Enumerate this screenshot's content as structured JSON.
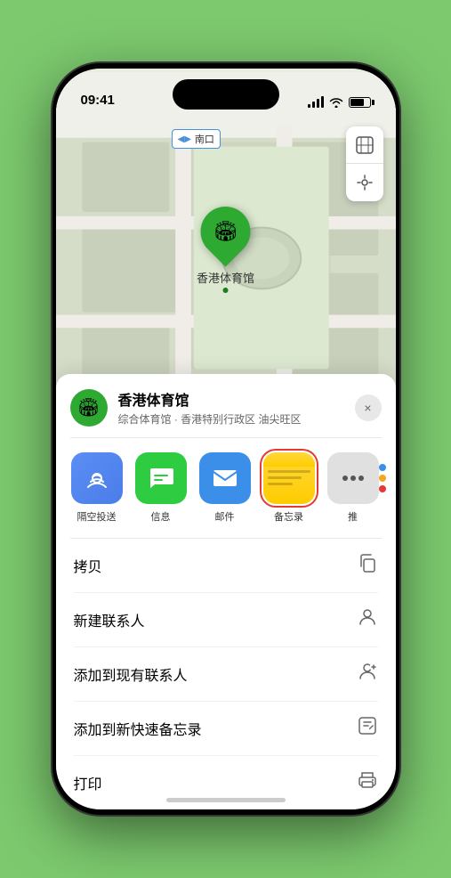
{
  "status_bar": {
    "time": "09:41",
    "location_icon": "▶"
  },
  "map": {
    "label_text": "南口",
    "pin_label": "香港体育馆",
    "controls": {
      "map_icon": "🗺",
      "location_icon": "➤"
    }
  },
  "sheet": {
    "venue_name": "香港体育馆",
    "venue_subtitle": "综合体育馆 · 香港特别行政区 油尖旺区",
    "close_label": "×"
  },
  "share_items": [
    {
      "id": "airdrop",
      "label": "隔空投送",
      "icon": "📡"
    },
    {
      "id": "messages",
      "label": "信息",
      "icon": "💬"
    },
    {
      "id": "mail",
      "label": "邮件",
      "icon": "✉"
    },
    {
      "id": "notes",
      "label": "备忘录",
      "icon": ""
    },
    {
      "id": "more",
      "label": "推",
      "icon": "⋯"
    }
  ],
  "actions": [
    {
      "id": "copy",
      "label": "拷贝",
      "icon": "⎘"
    },
    {
      "id": "new-contact",
      "label": "新建联系人",
      "icon": "👤"
    },
    {
      "id": "add-existing",
      "label": "添加到现有联系人",
      "icon": "👤"
    },
    {
      "id": "add-notes",
      "label": "添加到新快速备忘录",
      "icon": "🖊"
    },
    {
      "id": "print",
      "label": "打印",
      "icon": "🖨"
    }
  ],
  "colors": {
    "green": "#2eaa33",
    "blue": "#3b8fe8",
    "light_green_bg": "#7cc96e",
    "notes_highlight": "#e53935"
  }
}
